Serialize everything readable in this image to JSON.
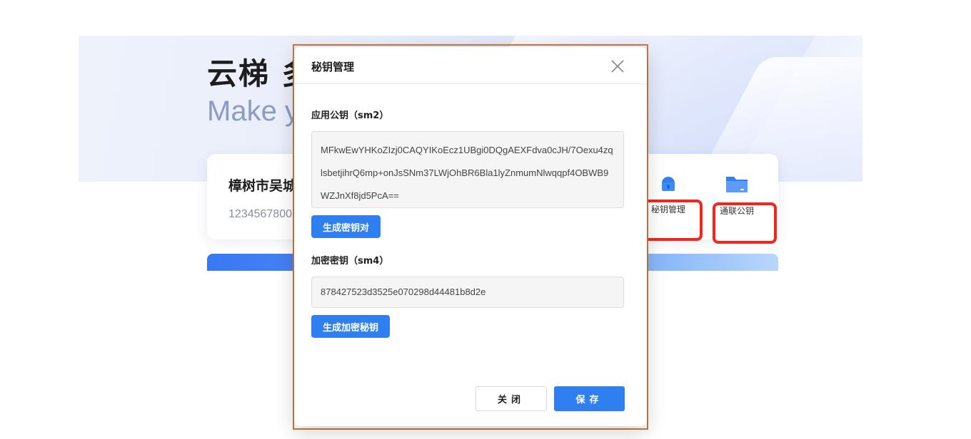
{
  "background": {
    "hero_title": "云梯 多",
    "hero_subtitle": "Make y",
    "company_name": "樟树市吴城",
    "company_code": "1234567800",
    "tools": [
      {
        "label": "秘钥管理",
        "icon": "lock-icon"
      },
      {
        "label": "通联公钥",
        "icon": "folder-icon"
      }
    ],
    "banner_text": "",
    "highlight_color": "#f2261c"
  },
  "modal": {
    "title": "秘钥管理",
    "app_public_key": {
      "label": "应用公钥（sm2）",
      "value": "MFkwEwYHKoZIzj0CAQYIKoEcz1UBgi0DQgAEXFdva0cJH/7Oexu4zqlsbetjihrQ6mp+onJsSNm37LWjOhBR6Bla1lyZnmumNlwqqpf4OBWB9WZJnXf8jd5PcA==",
      "generate_button": "生成密钥对"
    },
    "encryption_key": {
      "label": "加密密钥（sm4）",
      "value": "878427523d3525e070298d44481b8d2e",
      "generate_button": "生成加密秘钥"
    },
    "footer": {
      "close_button": "关闭",
      "save_button": "保存"
    },
    "accent_color": "#2f7ff0"
  }
}
